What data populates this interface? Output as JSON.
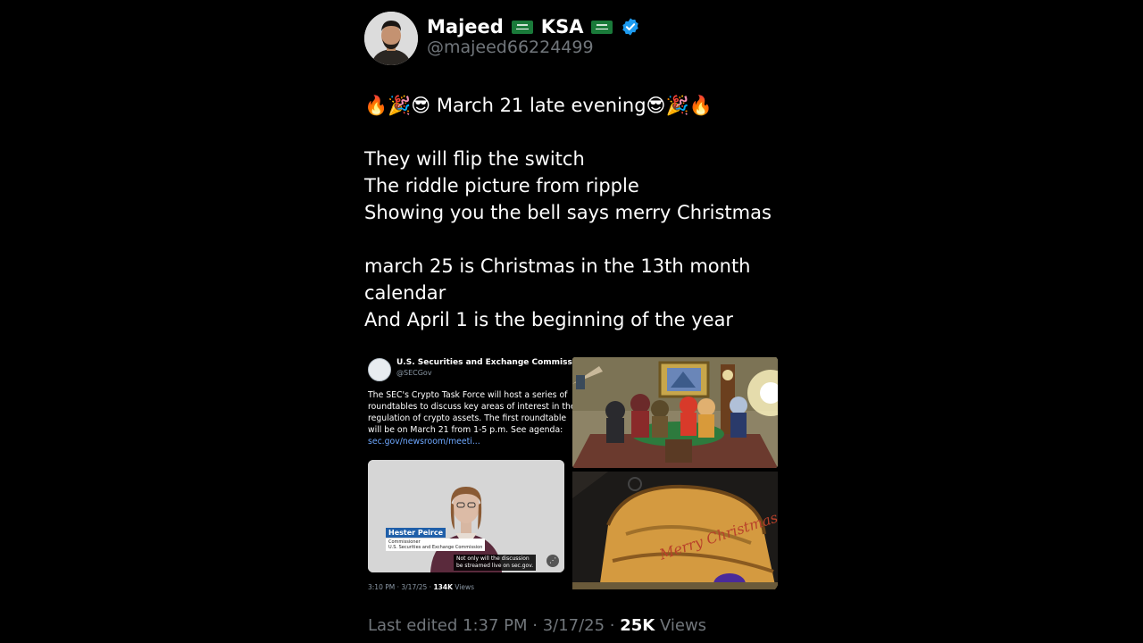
{
  "author": {
    "name": "Majeed",
    "country": "KSA",
    "handle": "@majeed66224499"
  },
  "tweet": {
    "headline_left_emoji": "🔥🎉😎",
    "headline": "March 21 late evening",
    "headline_right_emoji": "😎🎉🔥",
    "lines": [
      "They will flip the switch",
      "The riddle picture from ripple",
      "Showing you the bell says merry Christmas",
      "",
      "march 25 is Christmas in the 13th month",
      "calendar",
      "And April 1 is the beginning of the year"
    ]
  },
  "embedded": {
    "account_name": "U.S. Securities and Exchange Commission",
    "account_handle": "@SECGov",
    "text_lines": [
      "The SEC's Crypto Task Force will host a series of",
      "roundtables to discuss key areas of interest in the",
      "regulation of crypto assets. The first roundtable",
      "will be on March 21 from 1-5 p.m. See agenda:"
    ],
    "link": "sec.gov/newsroom/meeti...",
    "video": {
      "person_name": "Hester Peirce",
      "person_title_1": "Commissioner",
      "person_title_2": "U.S. Securities and Exchange Commission",
      "caption_1": "Not only will the discussion",
      "caption_2": "be streamed live on sec.gov."
    },
    "time": "3:10 PM · 3/17/25 · ",
    "views_count": "134K",
    "views_label": " Views"
  },
  "bell_text": "Merry Christmas",
  "footer": {
    "edited": "Last edited 1:37 PM · 3/17/25 · ",
    "views_count": "25K",
    "views_label": " Views"
  },
  "colors": {
    "background": "#000000",
    "verified": "#1d9bf0",
    "muted": "#71767b",
    "link": "#6ea8ff"
  }
}
